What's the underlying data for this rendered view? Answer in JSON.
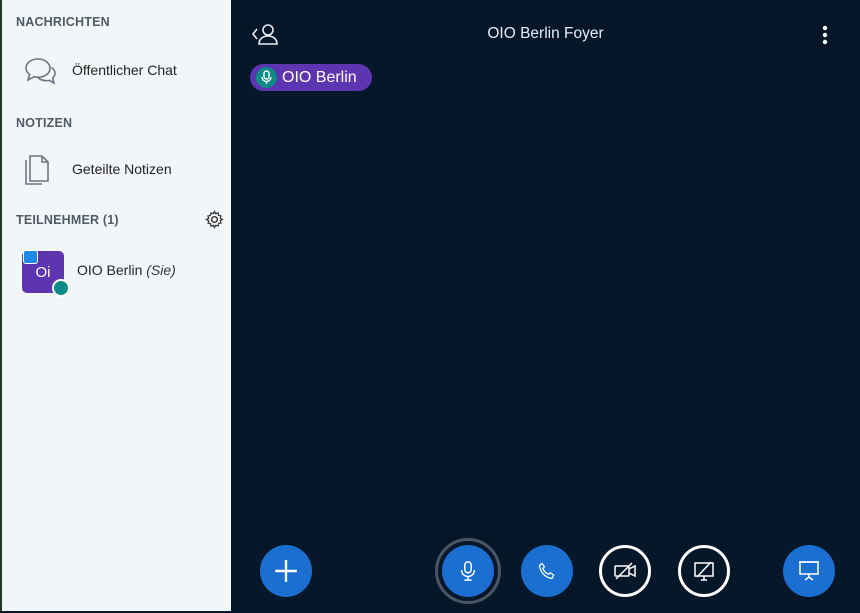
{
  "sidebar": {
    "messages_title": "NACHRICHTEN",
    "public_chat_label": "Öffentlicher Chat",
    "notes_title": "NOTIZEN",
    "shared_notes_label": "Geteilte Notizen",
    "participants_title": "TEILNEHMER (1)",
    "user": {
      "avatar_initials": "Oi",
      "name": "OIO Berlin",
      "you_suffix": "(Sie)"
    }
  },
  "main": {
    "meeting_title": "OIO Berlin Foyer",
    "talking_indicator": "OIO Berlin"
  },
  "colors": {
    "background": "#06172A",
    "sidebar": "#F3F6F9",
    "accent_blue": "#1B6FD1",
    "purple": "#5E35B1",
    "teal": "#0C8C87"
  },
  "icons": {
    "chat": "chat-bubbles-icon",
    "notes": "documents-icon",
    "settings": "gear-icon",
    "back_user": "user-back-icon",
    "more": "kebab-menu-icon",
    "mic": "microphone-icon",
    "phone": "phone-icon",
    "camera_off": "camera-off-icon",
    "screenshare_off": "screenshare-off-icon",
    "presentation": "presentation-icon",
    "add": "plus-icon"
  }
}
